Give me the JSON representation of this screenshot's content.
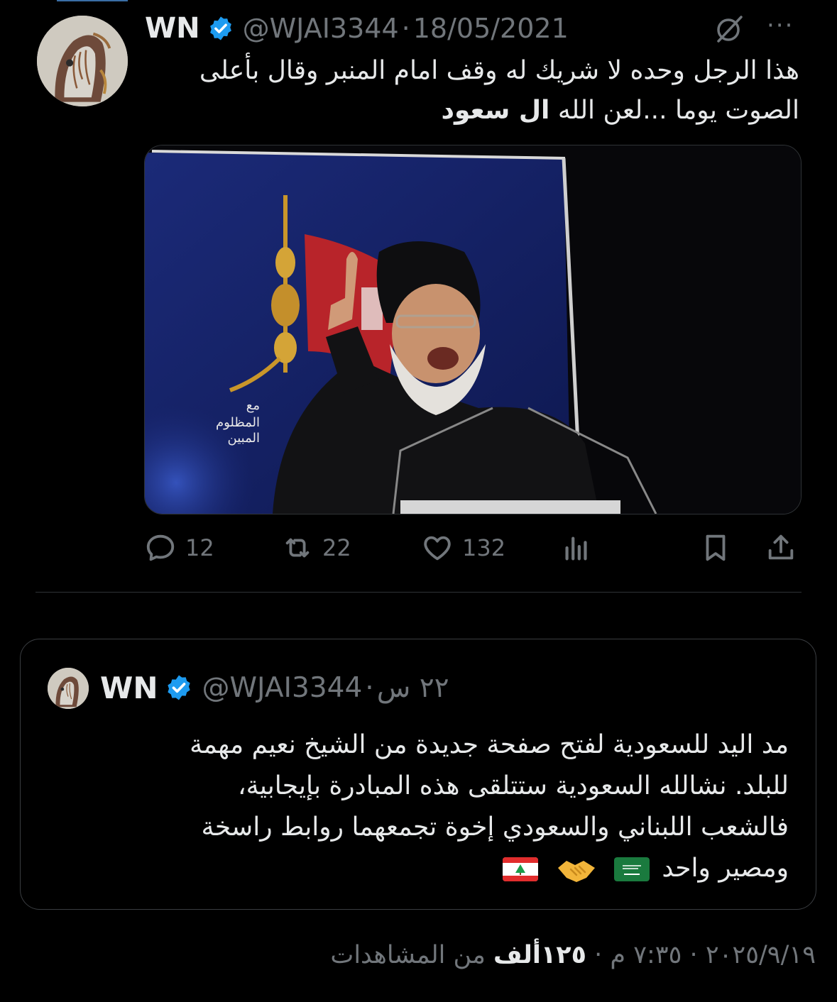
{
  "tweet": {
    "author_name": "WN",
    "handle": "@WJAI3344",
    "separator": "·",
    "date": "18/05/2021",
    "text_line1": "هذا الرجل وحده لا شريك له وقف امام المنبر وقال بأعلى",
    "text_line2_plain": "الصوت يوما ...لعن الله",
    "text_line2_bold": "ال سعود",
    "reply_count": "12",
    "retweet_count": "22",
    "like_count": "132",
    "image_caption_lines": [
      "مع",
      "المظلوم",
      "المبين"
    ]
  },
  "quote": {
    "author_name": "WN",
    "handle": "@WJAI3344",
    "separator": "·",
    "time": "٢٢ س",
    "text_line1": "مد اليد للسعودية لفتح صفحة جديدة من الشيخ نعيم مهمة",
    "text_line2": "للبلد. نشالله السعودية ستتلقى هذه المبادرة بإيجابية،",
    "text_line3": "فالشعب اللبناني والسعودي إخوة تجمعهما روابط راسخة",
    "text_line4": "ومصير واحد"
  },
  "footer": {
    "date": "٢٠٢٥/٩/١٩",
    "time": "٧:٣٥ م",
    "views_value": "١٢٥ألف",
    "views_label": "من المشاهدات",
    "separator": "·"
  },
  "colors": {
    "background": "#000000",
    "text_primary": "#e7e9ea",
    "text_secondary": "#71767b",
    "verified_blue": "#1d9bf0",
    "border": "#2f3336"
  },
  "icons": [
    "verified-badge-icon",
    "grok-icon",
    "more-icon",
    "reply-icon",
    "retweet-icon",
    "like-icon",
    "views-icon",
    "bookmark-icon",
    "share-icon",
    "saudi-flag-icon",
    "handshake-icon",
    "lebanon-flag-icon"
  ]
}
